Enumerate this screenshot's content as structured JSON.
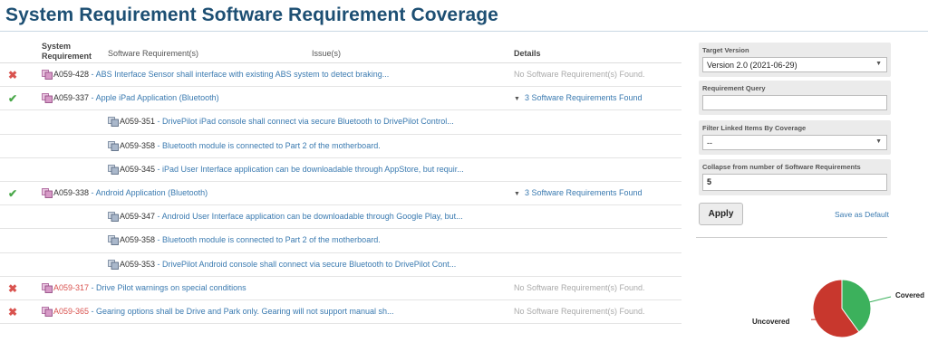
{
  "page": {
    "title": "System Requirement Software Requirement Coverage"
  },
  "table": {
    "headers": {
      "system_requirement": "System Requirement",
      "software_requirements": "Software Requirement(s)",
      "issues": "Issue(s)",
      "details": "Details"
    },
    "rows": [
      {
        "status": "✖",
        "id": "A059-428",
        "sep": " - ",
        "desc": "ABS Interface Sensor shall interface with existing ABS system to detect braking...",
        "details": "No Software Requirement(s) Found."
      },
      {
        "status": "✔",
        "id": "A059-337",
        "sep": " - ",
        "desc": "Apple iPad Application (Bluetooth)",
        "details": "3 Software Requirements Found"
      },
      {
        "id": "A059-351",
        "sep": " - ",
        "desc": "DrivePilot iPad console shall connect via secure Bluetooth to DrivePilot Control..."
      },
      {
        "id": "A059-358",
        "sep": " - ",
        "desc": "Bluetooth module is connected to Part 2 of the motherboard."
      },
      {
        "id": "A059-345",
        "sep": " - ",
        "desc": "iPad User Interface application can be downloadable through AppStore, but requir..."
      },
      {
        "status": "✔",
        "id": "A059-338",
        "sep": " - ",
        "desc": "Android Application (Bluetooth)",
        "details": "3 Software Requirements Found"
      },
      {
        "id": "A059-347",
        "sep": " - ",
        "desc": "Android User Interface application can be downloadable through Google Play, but..."
      },
      {
        "id": "A059-358",
        "sep": " - ",
        "desc": "Bluetooth module is connected to Part 2 of the motherboard."
      },
      {
        "id": "A059-353",
        "sep": " - ",
        "desc": "DrivePilot Android console shall connect via secure Bluetooth to DrivePilot Cont..."
      },
      {
        "status": "✖",
        "id": "A059-317",
        "sep": " - ",
        "desc": "Drive Pilot warnings on special conditions",
        "details": "No Software Requirement(s) Found."
      },
      {
        "status": "✖",
        "id": "A059-365",
        "sep": " - ",
        "desc": "Gearing options shall be Drive and Park only. Gearing will not support manual sh...",
        "details": "No Software Requirement(s) Found."
      }
    ]
  },
  "filters": {
    "target_version": {
      "label": "Target Version",
      "value": "Version 2.0 (2021-06-29)"
    },
    "requirement_query": {
      "label": "Requirement Query",
      "value": ""
    },
    "coverage_filter": {
      "label": "Filter Linked Items By Coverage",
      "value": "--"
    },
    "collapse": {
      "label": "Collapse from number of Software Requirements",
      "value": "5"
    },
    "apply_label": "Apply",
    "save_default_label": "Save as Default"
  },
  "colors": {
    "title": "#1d4f73",
    "link": "#3a7ab0",
    "fail": "#d9534f",
    "pass": "#4aa84a",
    "covered": "#3cb15c",
    "uncovered": "#c8372d"
  },
  "chart_data": {
    "type": "pie",
    "categories": [
      "Covered",
      "Uncovered"
    ],
    "values": [
      2,
      3
    ],
    "colors": [
      "#3cb15c",
      "#c8372d"
    ]
  }
}
